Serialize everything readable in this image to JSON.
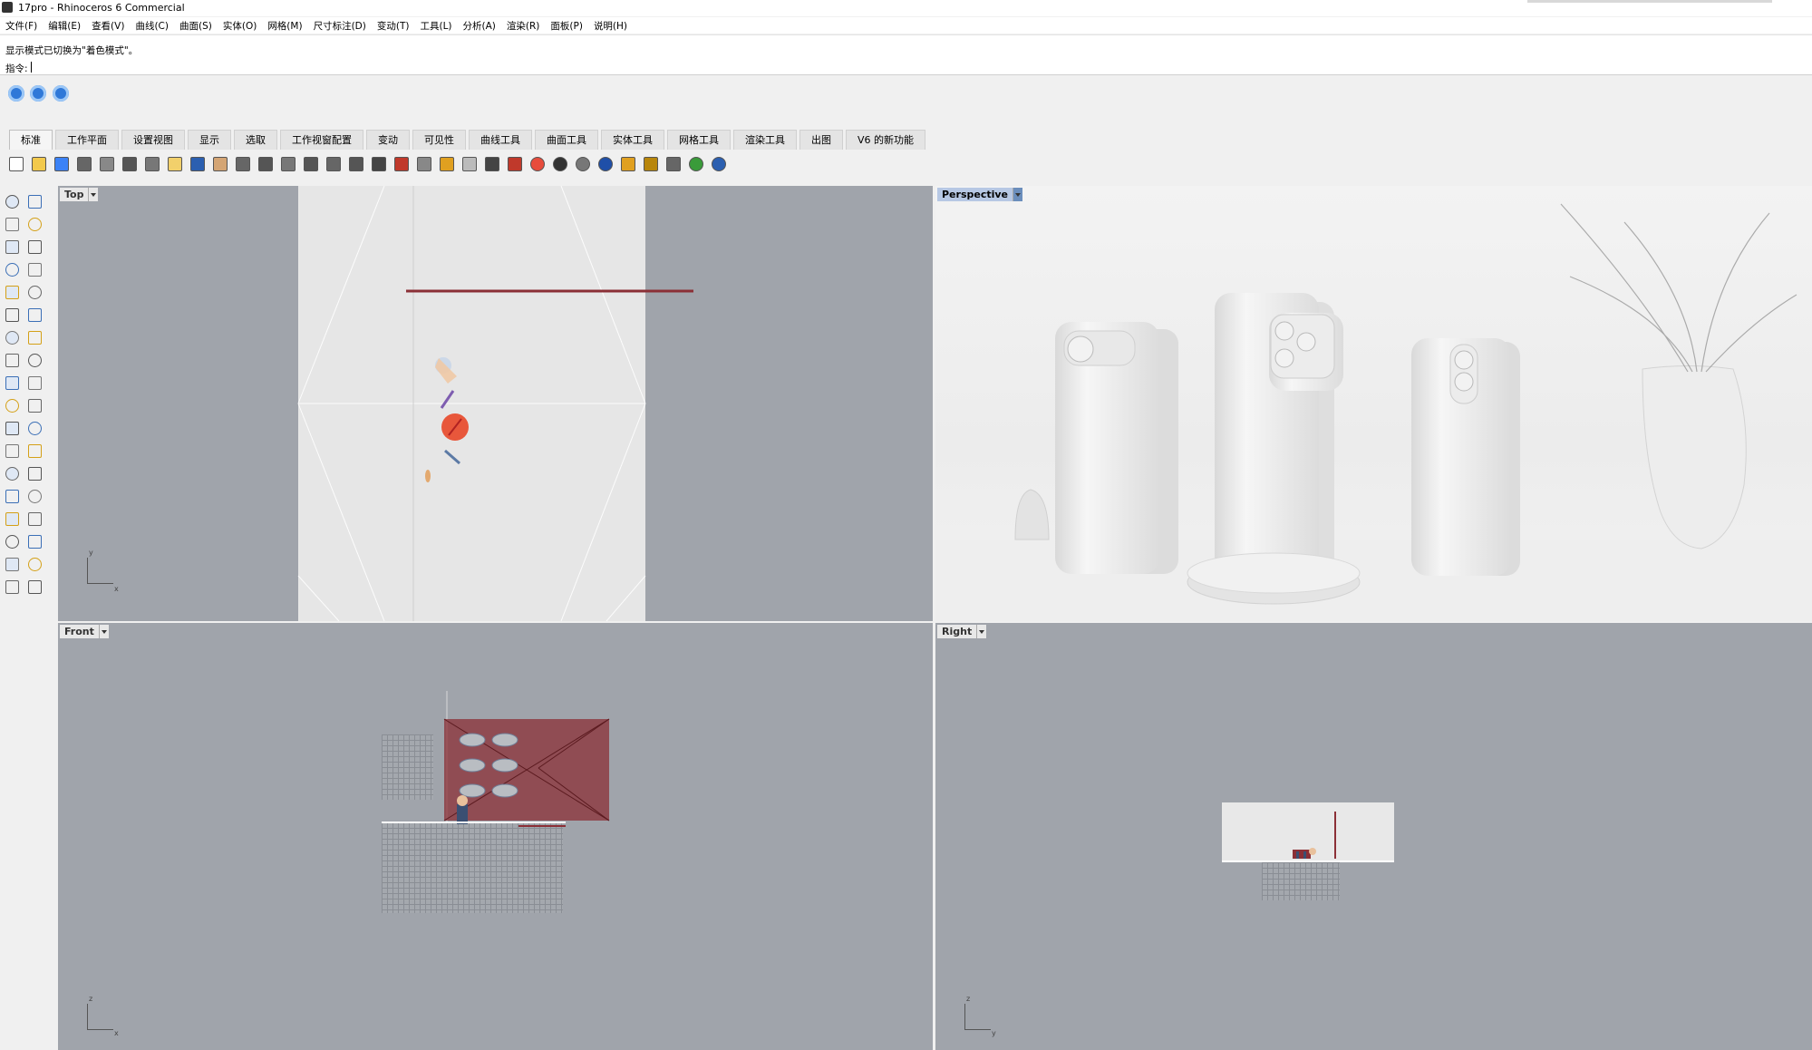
{
  "window": {
    "title": "17pro - Rhinoceros 6 Commercial"
  },
  "menu": [
    "文件(F)",
    "编辑(E)",
    "查看(V)",
    "曲线(C)",
    "曲面(S)",
    "实体(O)",
    "网格(M)",
    "尺寸标注(D)",
    "变动(T)",
    "工具(L)",
    "分析(A)",
    "渲染(R)",
    "面板(P)",
    "说明(H)"
  ],
  "command": {
    "history": "显示模式已切换为\"着色模式\"。",
    "prompt": "指令:",
    "value": ""
  },
  "quick_icons": [
    "osnap-icon",
    "smarttrack-icon",
    "gumball-icon"
  ],
  "tabs": [
    {
      "label": "标准",
      "active": true
    },
    {
      "label": "工作平面"
    },
    {
      "label": "设置视图"
    },
    {
      "label": "显示"
    },
    {
      "label": "选取"
    },
    {
      "label": "工作视窗配置"
    },
    {
      "label": "变动"
    },
    {
      "label": "可见性"
    },
    {
      "label": "曲线工具"
    },
    {
      "label": "曲面工具"
    },
    {
      "label": "实体工具"
    },
    {
      "label": "网格工具"
    },
    {
      "label": "渲染工具"
    },
    {
      "label": "出图"
    },
    {
      "label": "V6 的新功能"
    }
  ],
  "toolbar_icons": [
    "new-file-icon",
    "open-file-icon",
    "save-icon",
    "print-icon",
    "import-icon",
    "cut-icon",
    "copy-icon",
    "paste-icon",
    "undo-icon",
    "pan-icon",
    "rotate-view-icon",
    "zoom-icon",
    "zoom-window-icon",
    "zoom-extents-icon",
    "zoom-selected-icon",
    "undo-view-icon",
    "four-viewports-icon",
    "car-icon",
    "ellipse-icon",
    "snap-icon",
    "light-icon",
    "lock-icon",
    "material-icon",
    "color-wheel-icon",
    "sphere-dark-icon",
    "sphere-gray-icon",
    "sphere-blue-icon",
    "filter-icon",
    "settings-gear-icon",
    "cage-edit-icon",
    "globe-icon",
    "help-icon"
  ],
  "left_tools": [
    "select-arrow-icon",
    "point-icon",
    "polyline-icon",
    "curve-icon",
    "circle-icon",
    "arc-icon",
    "polygon-icon",
    "rectangle-icon",
    "ellipse-tool-icon",
    "fillet-icon",
    "surface-icon",
    "revolve-icon",
    "box-icon",
    "sphere-tool-icon",
    "cylinder-icon",
    "extrude-icon",
    "boolean-icon",
    "light-tool-icon",
    "transform-icon",
    "mirror-icon",
    "point-cloud-icon",
    "group-icon",
    "curve-edit-icon",
    "blend-icon",
    "text-icon",
    "dimension-icon",
    "block-icon",
    "layer-icon",
    "solid-icon",
    "ruler-icon",
    "array-icon",
    "history-icon",
    "clipping-icon",
    "check-icon",
    "mesh-icon",
    "render-tool-icon"
  ],
  "viewports": {
    "top": {
      "label": "Top",
      "axis1": "y",
      "axis2": "x"
    },
    "perspective": {
      "label": "Perspective"
    },
    "front": {
      "label": "Front",
      "axis1": "z",
      "axis2": "x"
    },
    "right": {
      "label": "Right",
      "axis1": "z",
      "axis2": "y"
    }
  },
  "colors": {
    "viewport_bg": "#a0a4ab",
    "model_red": "#8b2f36",
    "active_label": "#b7c8e4"
  }
}
